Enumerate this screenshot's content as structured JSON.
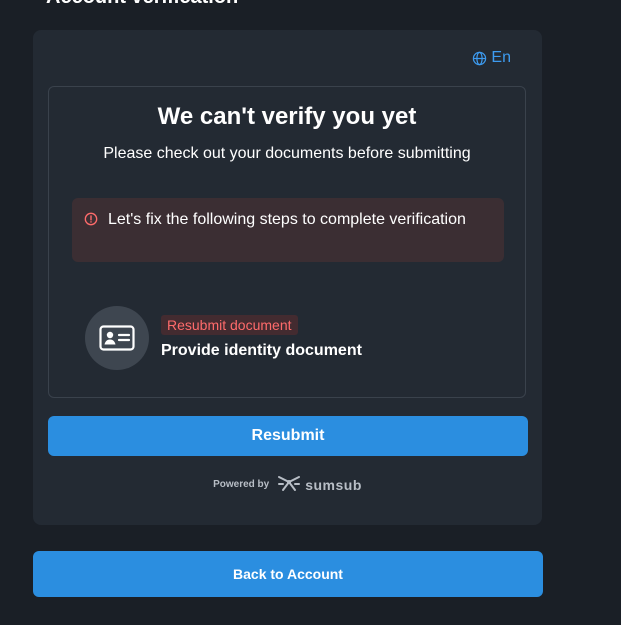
{
  "header": {
    "title": "Account verification"
  },
  "language": {
    "icon": "globe-icon",
    "label": "En"
  },
  "status": {
    "heading": "We can't verify you yet",
    "subheading": "Please check out your documents before submitting"
  },
  "alert": {
    "icon": "error-circle-icon",
    "message": "Let's fix the following steps to complete verification"
  },
  "steps": [
    {
      "icon": "id-card-icon",
      "badge": "Resubmit document",
      "label": "Provide identity document"
    }
  ],
  "actions": {
    "resubmit_label": "Resubmit",
    "back_label": "Back to Account"
  },
  "footer": {
    "powered_by": "Powered by",
    "brand": "sumsub"
  },
  "colors": {
    "accent": "#2b8ee0",
    "error": "#ff6b6b",
    "background": "#1a1f26",
    "card": "#232a33"
  }
}
